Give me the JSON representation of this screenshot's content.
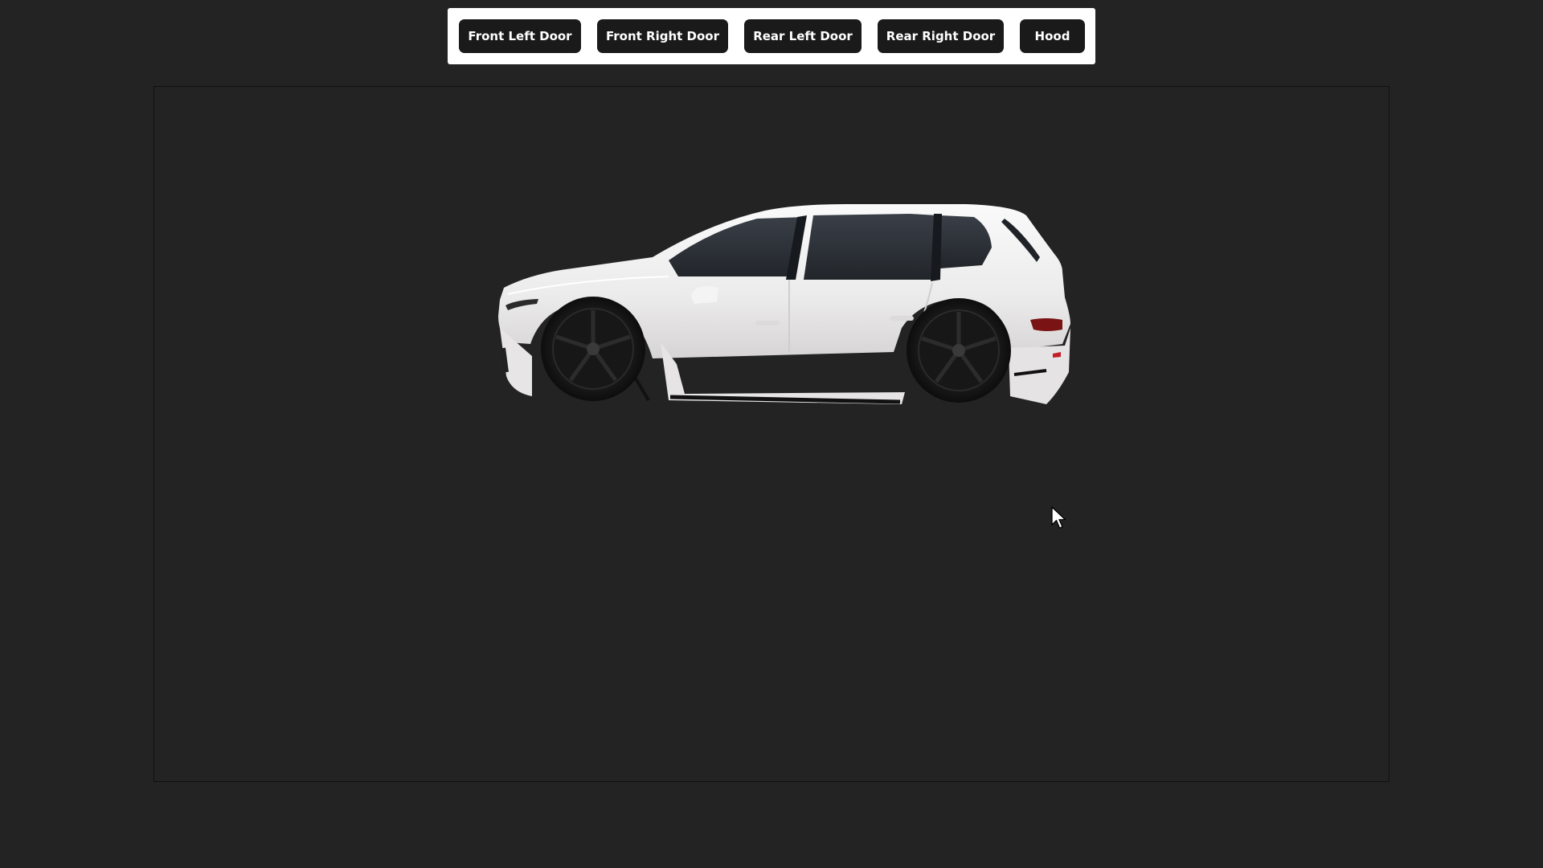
{
  "toolbar": {
    "buttons": [
      {
        "label": "Front Left Door"
      },
      {
        "label": "Front Right Door"
      },
      {
        "label": "Rear Left Door"
      },
      {
        "label": "Rear Right Door"
      },
      {
        "label": "Hood"
      }
    ]
  },
  "viewer": {
    "model_color": "#efeded",
    "wheel_color": "#161616"
  },
  "colors": {
    "page_background": "#232323",
    "toolbar_background": "#ffffff",
    "button_background": "#1a1a1a",
    "button_text": "#ffffff"
  }
}
